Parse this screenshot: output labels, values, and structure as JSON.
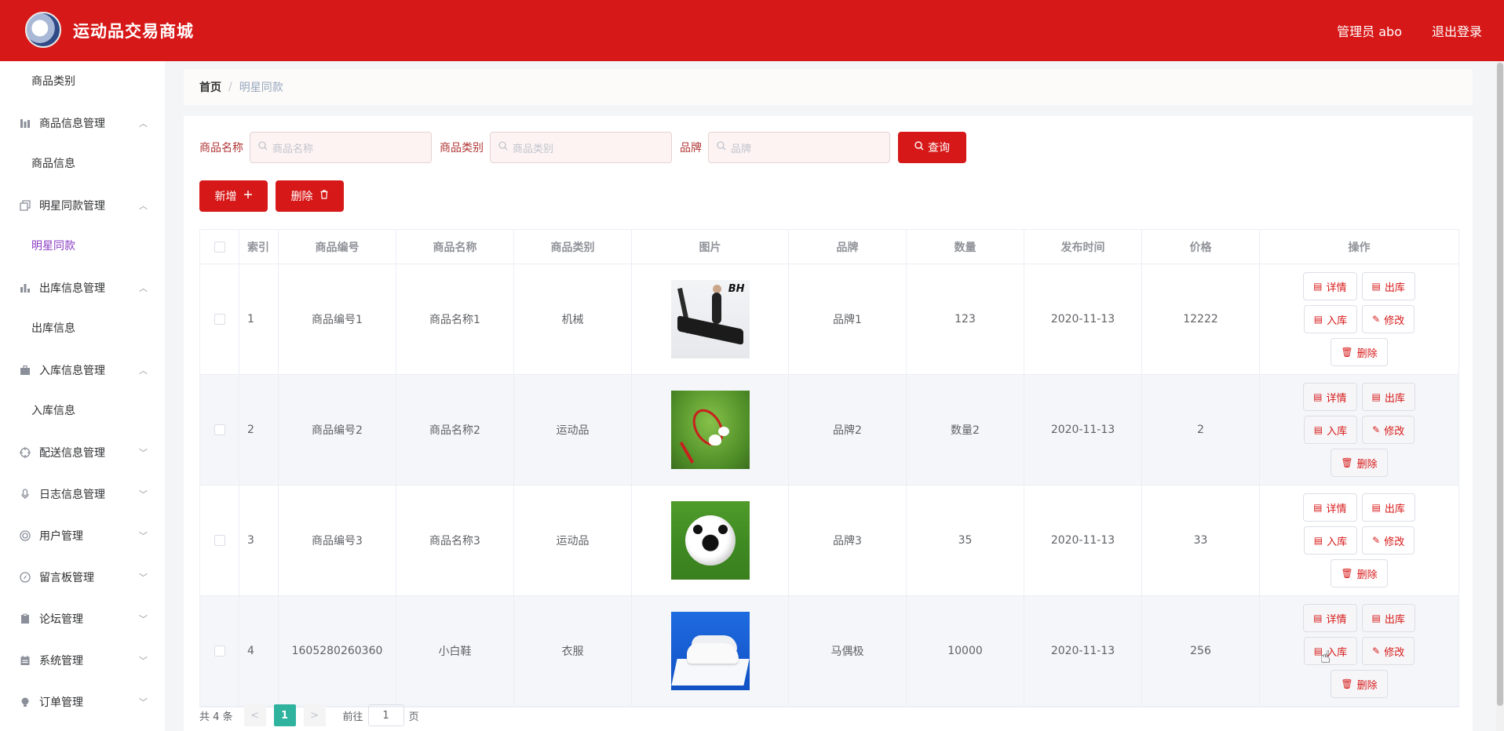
{
  "header": {
    "app_title": "运动品交易商城",
    "admin_label": "管理员 abo",
    "logout_label": "退出登录"
  },
  "sidebar": {
    "top_sub": "商品类别",
    "groups": [
      {
        "label": "商品信息管理",
        "icon": "bar-chart-icon",
        "expanded": true,
        "sub": "商品信息"
      },
      {
        "label": "明星同款管理",
        "icon": "copy-icon",
        "expanded": true,
        "sub": "明星同款"
      },
      {
        "label": "出库信息管理",
        "icon": "bar-chart-icon",
        "expanded": true,
        "sub": "出库信息"
      },
      {
        "label": "入库信息管理",
        "icon": "briefcase-icon",
        "expanded": true,
        "sub": "入库信息"
      },
      {
        "label": "配送信息管理",
        "icon": "crosshair-icon",
        "expanded": false
      },
      {
        "label": "日志信息管理",
        "icon": "mic-icon",
        "expanded": false
      },
      {
        "label": "用户管理",
        "icon": "globe-icon",
        "expanded": false
      },
      {
        "label": "留言板管理",
        "icon": "compass-icon",
        "expanded": false
      },
      {
        "label": "论坛管理",
        "icon": "clipboard-icon",
        "expanded": false
      },
      {
        "label": "系统管理",
        "icon": "calendar-icon",
        "expanded": false
      },
      {
        "label": "订单管理",
        "icon": "bulb-icon",
        "expanded": false
      }
    ]
  },
  "breadcrumb": {
    "home": "首页",
    "sep": "/",
    "current": "明星同款"
  },
  "search": {
    "name_label": "商品名称",
    "name_placeholder": "商品名称",
    "category_label": "商品类别",
    "category_placeholder": "商品类别",
    "brand_label": "品牌",
    "brand_placeholder": "品牌",
    "query_label": "查询"
  },
  "actions": {
    "add_label": "新增",
    "delete_label": "删除"
  },
  "table": {
    "headers": {
      "index": "索引",
      "code": "商品编号",
      "name": "商品名称",
      "category": "商品类别",
      "image": "图片",
      "brand": "品牌",
      "quantity": "数量",
      "date": "发布时间",
      "price": "价格",
      "ops": "操作"
    },
    "rows": [
      {
        "index": "1",
        "code": "商品编号1",
        "name": "商品名称1",
        "category": "机械",
        "image": "treadmill",
        "image_text": "BH",
        "brand": "品牌1",
        "quantity": "123",
        "date": "2020-11-13",
        "price": "12222"
      },
      {
        "index": "2",
        "code": "商品编号2",
        "name": "商品名称2",
        "category": "运动品",
        "image": "badminton",
        "brand": "品牌2",
        "quantity": "数量2",
        "date": "2020-11-13",
        "price": "2"
      },
      {
        "index": "3",
        "code": "商品编号3",
        "name": "商品名称3",
        "category": "运动品",
        "image": "soccer-ball",
        "brand": "品牌3",
        "quantity": "35",
        "date": "2020-11-13",
        "price": "33"
      },
      {
        "index": "4",
        "code": "1605280260360",
        "name": "小白鞋",
        "category": "衣服",
        "image": "white-shoes",
        "brand": "马偶极",
        "quantity": "10000",
        "date": "2020-11-13",
        "price": "256"
      }
    ],
    "op_labels": {
      "detail": "详情",
      "out": "出库",
      "in": "入库",
      "edit": "修改",
      "delete": "删除"
    }
  },
  "pagination": {
    "total": "共 4 条",
    "prev": "<",
    "page": "1",
    "next": ">",
    "goto_prefix": "前往",
    "goto_value": "1",
    "goto_suffix": "页"
  },
  "colors": {
    "brand": "#d71818",
    "active_menu": "#8a3cc2",
    "page_active": "#2fb39e"
  }
}
